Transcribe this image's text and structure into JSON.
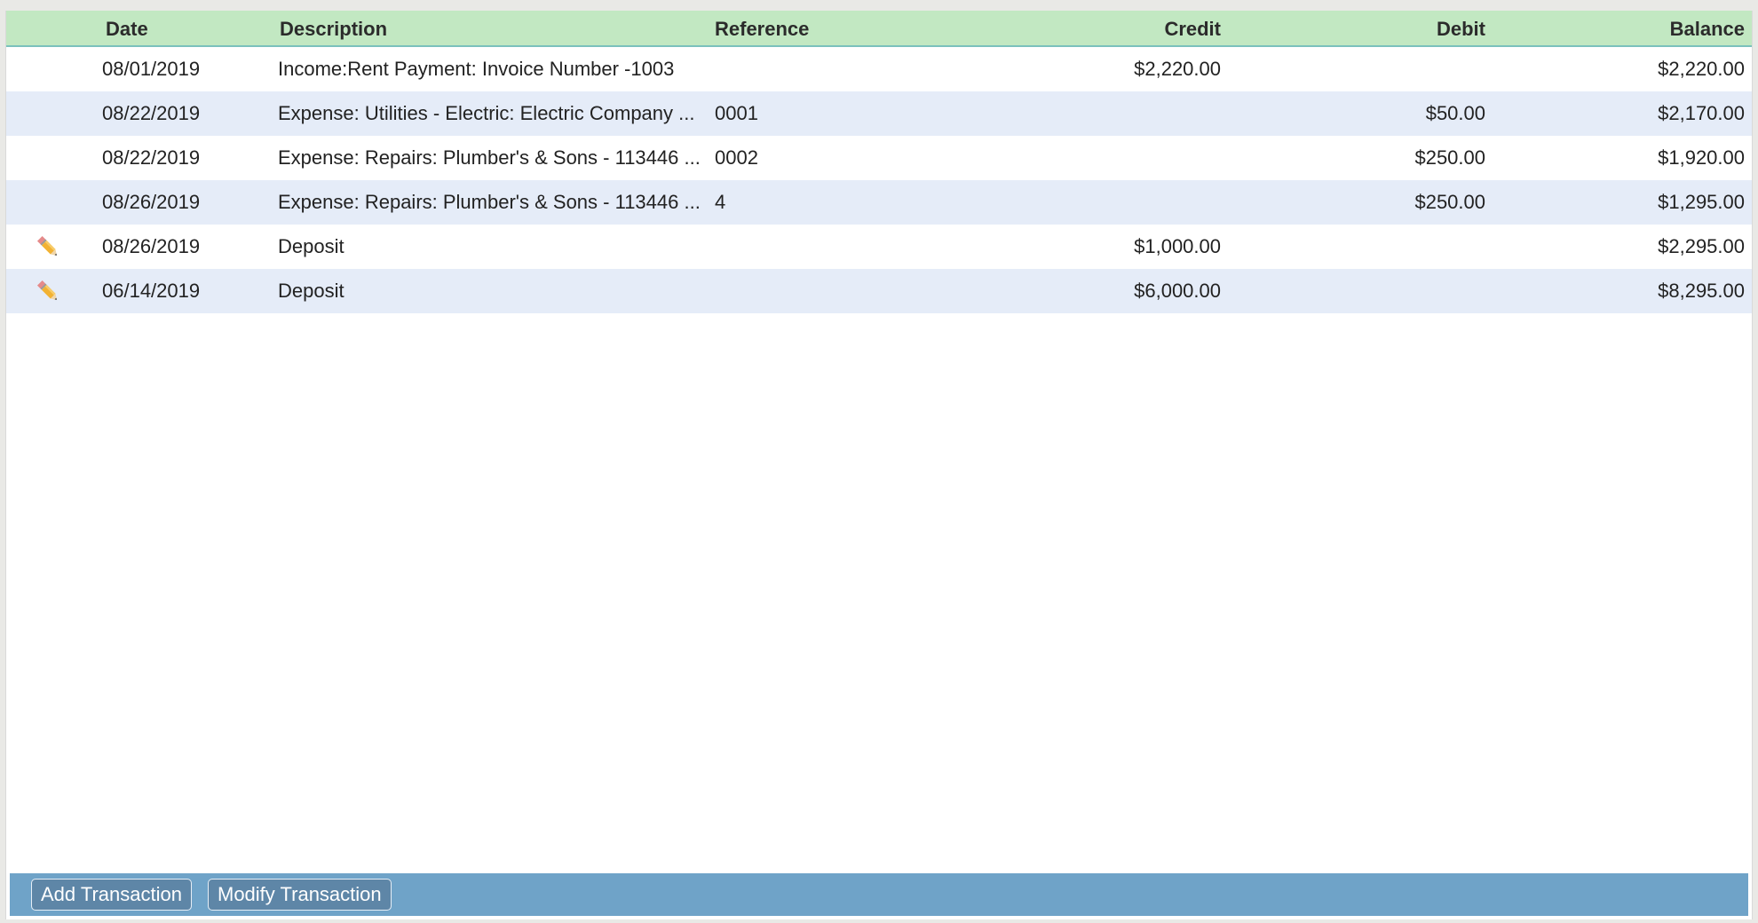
{
  "table": {
    "columns": {
      "date": "Date",
      "description": "Description",
      "reference": "Reference",
      "credit": "Credit",
      "debit": "Debit",
      "balance": "Balance"
    },
    "rows": [
      {
        "editable": false,
        "date": "08/01/2019",
        "description": "Income:Rent Payment: Invoice Number -1003",
        "reference": "",
        "credit": "$2,220.00",
        "debit": "",
        "balance": "$2,220.00"
      },
      {
        "editable": false,
        "date": "08/22/2019",
        "description": "Expense: Utilities - Electric: Electric Company  ...",
        "reference": "0001",
        "credit": "",
        "debit": "$50.00",
        "balance": "$2,170.00"
      },
      {
        "editable": false,
        "date": "08/22/2019",
        "description": "Expense: Repairs: Plumber's & Sons - 113446 ...",
        "reference": "0002",
        "credit": "",
        "debit": "$250.00",
        "balance": "$1,920.00"
      },
      {
        "editable": false,
        "date": "08/26/2019",
        "description": "Expense: Repairs: Plumber's & Sons - 113446 ...",
        "reference": "4",
        "credit": "",
        "debit": "$250.00",
        "balance": "$1,295.00"
      },
      {
        "editable": true,
        "date": "08/26/2019",
        "description": "Deposit",
        "reference": "",
        "credit": "$1,000.00",
        "debit": "",
        "balance": "$2,295.00"
      },
      {
        "editable": true,
        "date": "06/14/2019",
        "description": "Deposit",
        "reference": "",
        "credit": "$6,000.00",
        "debit": "",
        "balance": "$8,295.00"
      }
    ]
  },
  "toolbar": {
    "add_label": "Add Transaction",
    "modify_label": "Modify Transaction"
  },
  "colors": {
    "header_bg": "#c2e8c2",
    "alt_row_bg": "#e5ecf8",
    "toolbar_bg": "#6fa3c8"
  },
  "icons": {
    "edit": "pencil-icon"
  }
}
